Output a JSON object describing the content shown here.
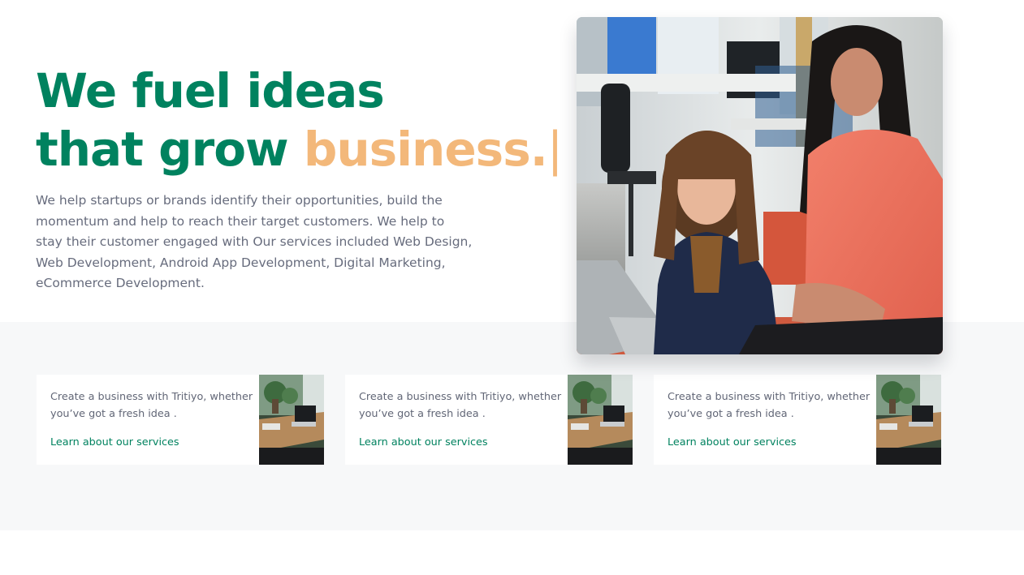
{
  "hero": {
    "heading_line1": "We fuel ideas",
    "heading_line2_prefix": "that grow ",
    "heading_line2_accent": "business.",
    "cursor": "|",
    "description": "We help startups or brands identify their opportunities, build the momentum and help to reach their target customers. We help to stay their customer engaged with Our services included Web Design, Web Development, Android App Development, Digital Marketing, eCommerce Development."
  },
  "cards": [
    {
      "text": "Create a business with Tritiyo, whether you’ve got a fresh idea .",
      "link_label": "Learn about our services"
    },
    {
      "text": "Create a business with Tritiyo, whether you’ve got a fresh idea .",
      "link_label": "Learn about our services"
    },
    {
      "text": "Create a business with Tritiyo, whether you’ve got a fresh idea .",
      "link_label": "Learn about our services"
    }
  ],
  "colors": {
    "brand_green": "#00825f",
    "accent_orange": "#f3b87a",
    "body_text": "#676c7d",
    "band_background": "#f7f8f9"
  }
}
